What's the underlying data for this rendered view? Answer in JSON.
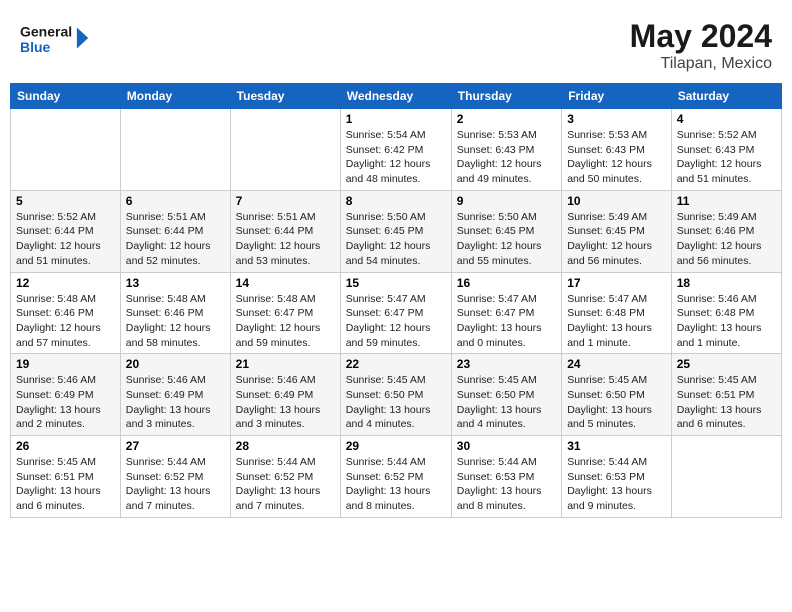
{
  "header": {
    "logo_line1": "General",
    "logo_line2": "Blue",
    "month_year": "May 2024",
    "location": "Tilapan, Mexico"
  },
  "weekdays": [
    "Sunday",
    "Monday",
    "Tuesday",
    "Wednesday",
    "Thursday",
    "Friday",
    "Saturday"
  ],
  "weeks": [
    [
      {
        "day": "",
        "info": ""
      },
      {
        "day": "",
        "info": ""
      },
      {
        "day": "",
        "info": ""
      },
      {
        "day": "1",
        "info": "Sunrise: 5:54 AM\nSunset: 6:42 PM\nDaylight: 12 hours\nand 48 minutes."
      },
      {
        "day": "2",
        "info": "Sunrise: 5:53 AM\nSunset: 6:43 PM\nDaylight: 12 hours\nand 49 minutes."
      },
      {
        "day": "3",
        "info": "Sunrise: 5:53 AM\nSunset: 6:43 PM\nDaylight: 12 hours\nand 50 minutes."
      },
      {
        "day": "4",
        "info": "Sunrise: 5:52 AM\nSunset: 6:43 PM\nDaylight: 12 hours\nand 51 minutes."
      }
    ],
    [
      {
        "day": "5",
        "info": "Sunrise: 5:52 AM\nSunset: 6:44 PM\nDaylight: 12 hours\nand 51 minutes."
      },
      {
        "day": "6",
        "info": "Sunrise: 5:51 AM\nSunset: 6:44 PM\nDaylight: 12 hours\nand 52 minutes."
      },
      {
        "day": "7",
        "info": "Sunrise: 5:51 AM\nSunset: 6:44 PM\nDaylight: 12 hours\nand 53 minutes."
      },
      {
        "day": "8",
        "info": "Sunrise: 5:50 AM\nSunset: 6:45 PM\nDaylight: 12 hours\nand 54 minutes."
      },
      {
        "day": "9",
        "info": "Sunrise: 5:50 AM\nSunset: 6:45 PM\nDaylight: 12 hours\nand 55 minutes."
      },
      {
        "day": "10",
        "info": "Sunrise: 5:49 AM\nSunset: 6:45 PM\nDaylight: 12 hours\nand 56 minutes."
      },
      {
        "day": "11",
        "info": "Sunrise: 5:49 AM\nSunset: 6:46 PM\nDaylight: 12 hours\nand 56 minutes."
      }
    ],
    [
      {
        "day": "12",
        "info": "Sunrise: 5:48 AM\nSunset: 6:46 PM\nDaylight: 12 hours\nand 57 minutes."
      },
      {
        "day": "13",
        "info": "Sunrise: 5:48 AM\nSunset: 6:46 PM\nDaylight: 12 hours\nand 58 minutes."
      },
      {
        "day": "14",
        "info": "Sunrise: 5:48 AM\nSunset: 6:47 PM\nDaylight: 12 hours\nand 59 minutes."
      },
      {
        "day": "15",
        "info": "Sunrise: 5:47 AM\nSunset: 6:47 PM\nDaylight: 12 hours\nand 59 minutes."
      },
      {
        "day": "16",
        "info": "Sunrise: 5:47 AM\nSunset: 6:47 PM\nDaylight: 13 hours\nand 0 minutes."
      },
      {
        "day": "17",
        "info": "Sunrise: 5:47 AM\nSunset: 6:48 PM\nDaylight: 13 hours\nand 1 minute."
      },
      {
        "day": "18",
        "info": "Sunrise: 5:46 AM\nSunset: 6:48 PM\nDaylight: 13 hours\nand 1 minute."
      }
    ],
    [
      {
        "day": "19",
        "info": "Sunrise: 5:46 AM\nSunset: 6:49 PM\nDaylight: 13 hours\nand 2 minutes."
      },
      {
        "day": "20",
        "info": "Sunrise: 5:46 AM\nSunset: 6:49 PM\nDaylight: 13 hours\nand 3 minutes."
      },
      {
        "day": "21",
        "info": "Sunrise: 5:46 AM\nSunset: 6:49 PM\nDaylight: 13 hours\nand 3 minutes."
      },
      {
        "day": "22",
        "info": "Sunrise: 5:45 AM\nSunset: 6:50 PM\nDaylight: 13 hours\nand 4 minutes."
      },
      {
        "day": "23",
        "info": "Sunrise: 5:45 AM\nSunset: 6:50 PM\nDaylight: 13 hours\nand 4 minutes."
      },
      {
        "day": "24",
        "info": "Sunrise: 5:45 AM\nSunset: 6:50 PM\nDaylight: 13 hours\nand 5 minutes."
      },
      {
        "day": "25",
        "info": "Sunrise: 5:45 AM\nSunset: 6:51 PM\nDaylight: 13 hours\nand 6 minutes."
      }
    ],
    [
      {
        "day": "26",
        "info": "Sunrise: 5:45 AM\nSunset: 6:51 PM\nDaylight: 13 hours\nand 6 minutes."
      },
      {
        "day": "27",
        "info": "Sunrise: 5:44 AM\nSunset: 6:52 PM\nDaylight: 13 hours\nand 7 minutes."
      },
      {
        "day": "28",
        "info": "Sunrise: 5:44 AM\nSunset: 6:52 PM\nDaylight: 13 hours\nand 7 minutes."
      },
      {
        "day": "29",
        "info": "Sunrise: 5:44 AM\nSunset: 6:52 PM\nDaylight: 13 hours\nand 8 minutes."
      },
      {
        "day": "30",
        "info": "Sunrise: 5:44 AM\nSunset: 6:53 PM\nDaylight: 13 hours\nand 8 minutes."
      },
      {
        "day": "31",
        "info": "Sunrise: 5:44 AM\nSunset: 6:53 PM\nDaylight: 13 hours\nand 9 minutes."
      },
      {
        "day": "",
        "info": ""
      }
    ]
  ]
}
